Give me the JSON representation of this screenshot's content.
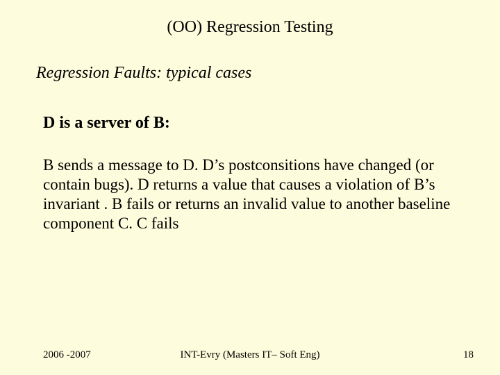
{
  "title": "(OO) Regression Testing",
  "subtitle": "Regression Faults: typical cases",
  "heading": "D is a server of B:",
  "body": "B sends a message to D. D’s postconsitions have changed (or contain bugs). D returns a value that causes a violation of B’s invariant . B fails or returns an invalid value to another baseline component C. C fails",
  "footer": {
    "left": "2006 -2007",
    "center": "INT-Evry (Masters IT– Soft Eng)",
    "right": "18"
  }
}
